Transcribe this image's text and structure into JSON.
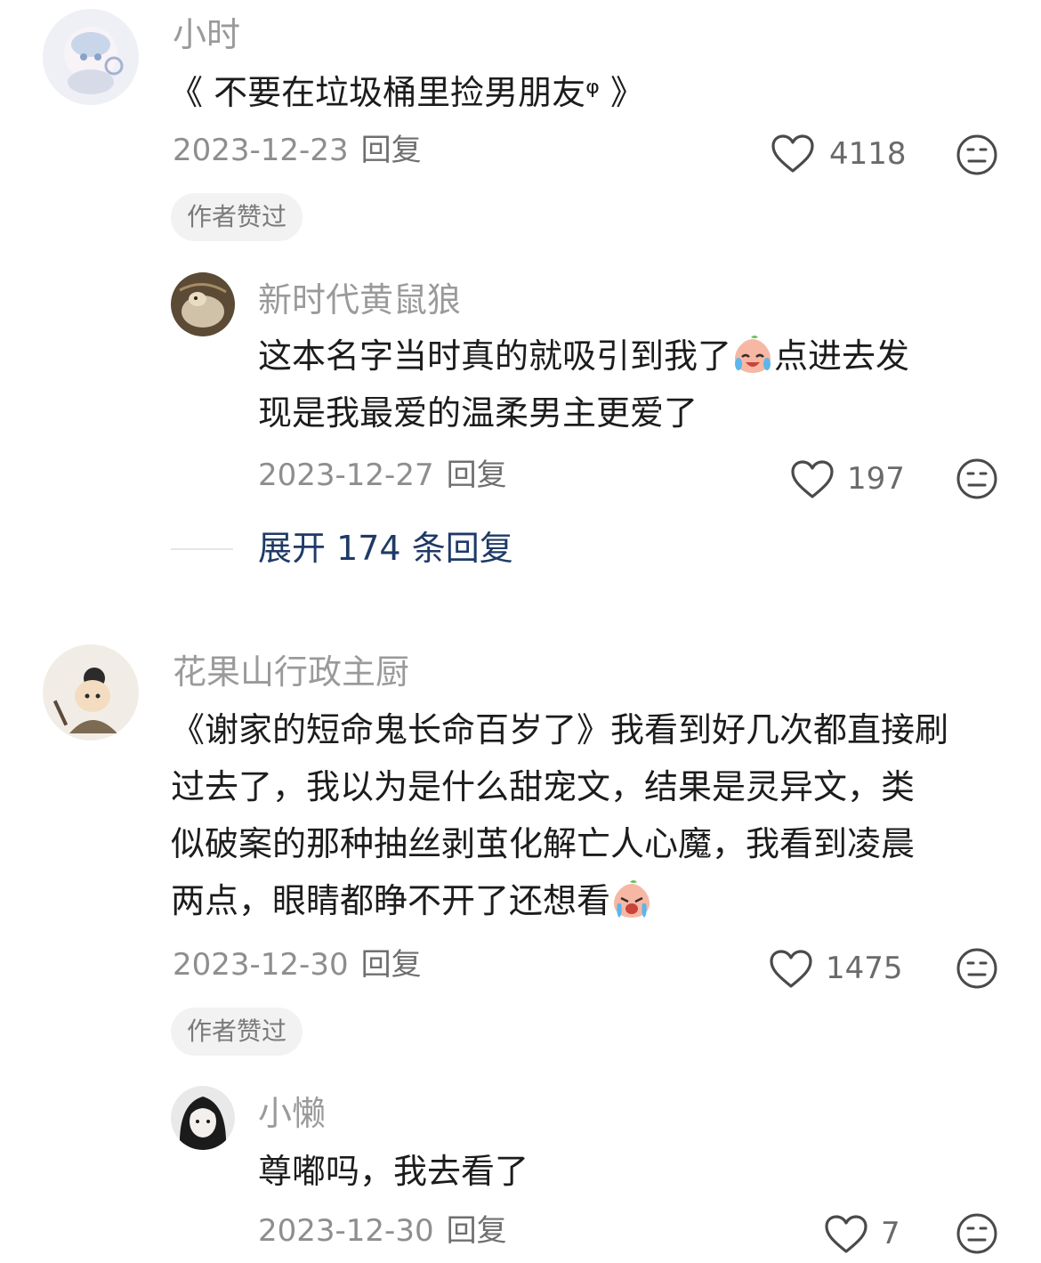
{
  "comments": [
    {
      "username": "小时",
      "text": "《 不要在垃圾桶里捡男朋友ᵠ 》",
      "date": "2023-12-23",
      "reply_label": "回复",
      "likes": "4118",
      "author_liked_badge": "作者赞过",
      "replies": [
        {
          "username": "新时代黄鼠狼",
          "text_line1": "这本名字当时真的就吸引到我了",
          "text_line1_after": "点进去发",
          "text_line2": "现是我最爱的温柔男主更爱了",
          "date": "2023-12-27",
          "reply_label": "回复",
          "likes": "197"
        }
      ],
      "expand_label": "展开 174 条回复"
    },
    {
      "username": "花果山行政主厨",
      "text_lines": [
        "《谢家的短命鬼长命百岁了》我看到好几次都直接刷",
        "过去了，我以为是什么甜宠文，结果是灵异文，类",
        "似破案的那种抽丝剥茧化解亡人心魔，我看到凌晨",
        "两点，眼睛都睁不开了还想看"
      ],
      "date": "2023-12-30",
      "reply_label": "回复",
      "likes": "1475",
      "author_liked_badge": "作者赞过",
      "replies": [
        {
          "username": "小懒",
          "text": "尊嘟吗，我去看了",
          "date": "2023-12-30",
          "reply_label": "回复",
          "likes": "7"
        }
      ]
    }
  ],
  "icons": {
    "like": "heart-outline-icon",
    "dislike": "neutral-face-icon",
    "emoji_cry_laugh": "crying-laughing-peach-emoji",
    "emoji_sob": "sobbing-peach-emoji"
  }
}
